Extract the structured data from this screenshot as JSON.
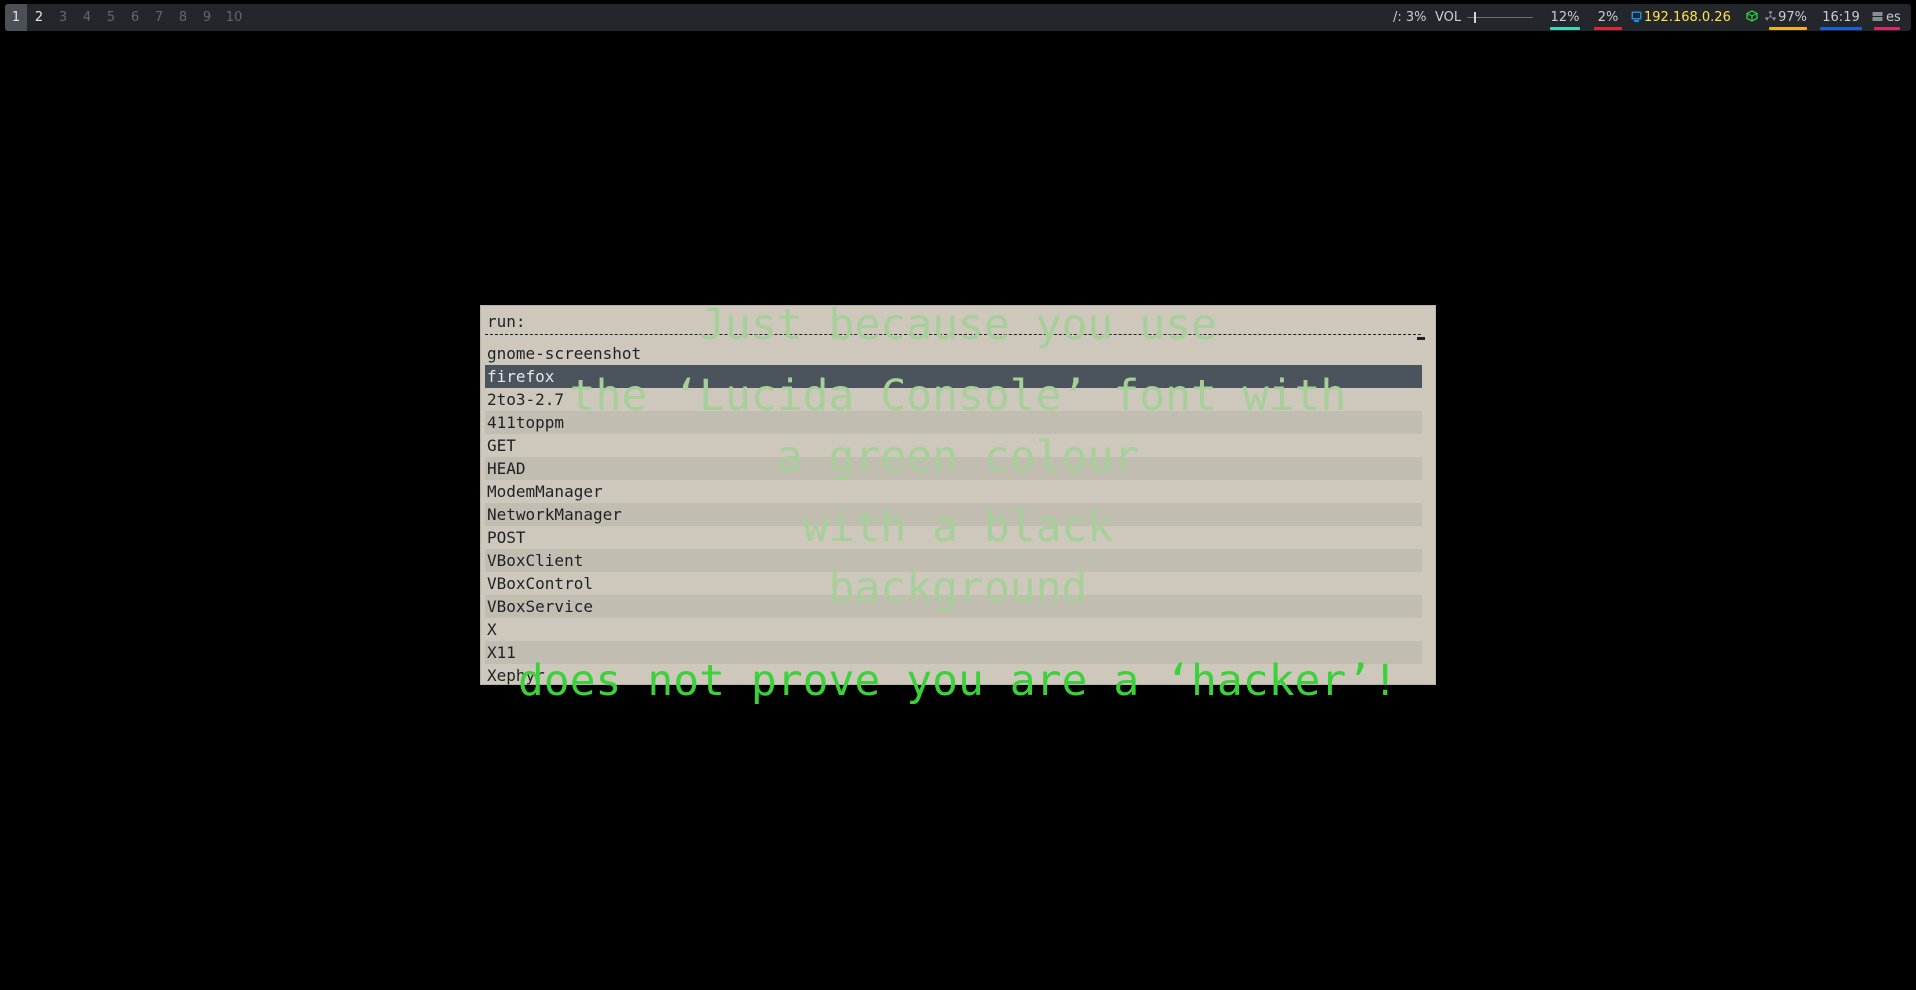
{
  "topbar": {
    "workspaces": [
      "1",
      "2",
      "3",
      "4",
      "5",
      "6",
      "7",
      "8",
      "9",
      "10"
    ],
    "active_workspace": "1",
    "root_usage": "/: 3%",
    "volume_label": "VOL",
    "cpu": "12%",
    "mem": "2%",
    "ip": "192.168.0.26",
    "battery": "97%",
    "clock": "16:19",
    "layout": "es",
    "colors": {
      "cpu": "#3fd6c2",
      "mem": "#e0262e",
      "battery": "#f0b31f",
      "clock": "#1a5fe0",
      "layout": "#e0246a",
      "ip": "#ffe44d"
    }
  },
  "launcher": {
    "prompt": "run:",
    "items": [
      "gnome-screenshot",
      "firefox",
      "2to3-2.7",
      "411toppm",
      "GET",
      "HEAD",
      "ModemManager",
      "NetworkManager",
      "POST",
      "VBoxClient",
      "VBoxControl",
      "VBoxService",
      "X",
      "X11",
      "Xephyr"
    ],
    "selected_index": 1
  },
  "overlay": {
    "line1": "Just because you use",
    "line2": "the ‘Lucida Console’ font with",
    "line3": "a green colour",
    "line4": "with a black",
    "line5": "background",
    "line6": "does not prove you are a ‘hacker’!"
  }
}
